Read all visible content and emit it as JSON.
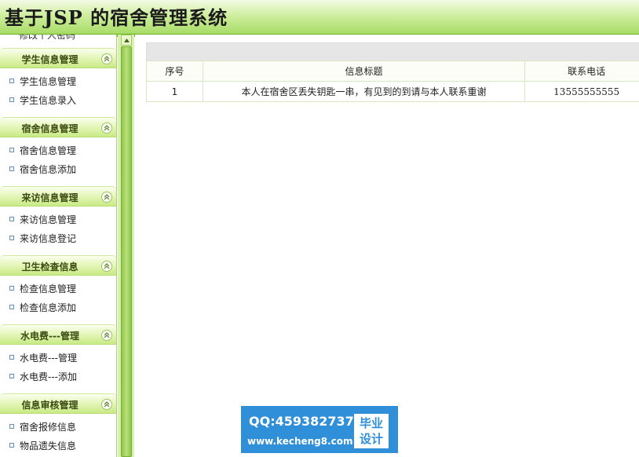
{
  "app": {
    "title": "基于JSP 的宿舍管理系统"
  },
  "sidebar": {
    "partial_item": "修改个人密码",
    "groups": [
      {
        "label": "学生信息管理",
        "items": [
          "学生信息管理",
          "学生信息录入"
        ]
      },
      {
        "label": "宿舍信息管理",
        "items": [
          "宿舍信息管理",
          "宿舍信息添加"
        ]
      },
      {
        "label": "来访信息管理",
        "items": [
          "来访信息管理",
          "来访信息登记"
        ]
      },
      {
        "label": "卫生检查信息",
        "items": [
          "检查信息管理",
          "检查信息添加"
        ]
      },
      {
        "label": "水电费---管理",
        "items": [
          "水电费---管理",
          "水电费---添加"
        ]
      },
      {
        "label": "信息审核管理",
        "items": [
          "宿舍报修信息",
          "物品遗失信息"
        ]
      }
    ]
  },
  "table": {
    "headers": [
      "序号",
      "信息标题",
      "联系电话"
    ],
    "rows": [
      [
        "1",
        "本人在宿舍区丢失钥匙一串，有见到的到请与本人联系重谢",
        "13555555555"
      ]
    ]
  },
  "watermark": {
    "qq": "QQ:459382737",
    "site": "www.kecheng8.com",
    "badge_line1": "毕业",
    "badge_line2": "设计"
  },
  "colors": {
    "accent": "#8fc64c",
    "header_green": "#a8dc66",
    "watermark_blue": "#2f8fd8"
  }
}
